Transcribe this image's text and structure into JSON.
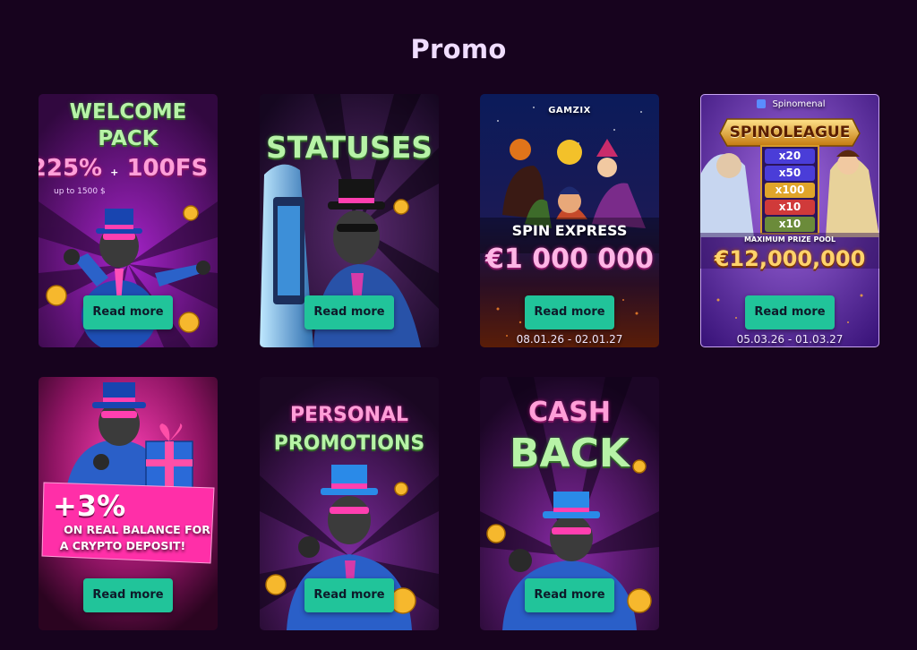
{
  "page": {
    "title": "Promo"
  },
  "promos": [
    {
      "name": "welcome-pack",
      "line1": "WELCOME",
      "line2": "PACK",
      "percent": "225%",
      "plus": "+",
      "freespins": "100FS",
      "note": "up to 1500 $",
      "button": "Read more"
    },
    {
      "name": "statuses",
      "line1": "STATUSES",
      "button": "Read more"
    },
    {
      "name": "spin-express",
      "brand": "GAMZIX",
      "line1": "SPIN EXPRESS",
      "prize": "€1 000 000",
      "dates": "08.01.26 - 02.01.27",
      "button": "Read more"
    },
    {
      "name": "spinoleague",
      "brand": "Spinomenal",
      "line1": "SPINOLEAGUE",
      "multipliers": [
        "x20",
        "x50",
        "x100",
        "x10",
        "x10"
      ],
      "pool_label": "MAXIMUM PRIZE POOL",
      "prize": "€12,000,000",
      "dates": "05.03.26 - 01.03.27",
      "button": "Read more"
    },
    {
      "name": "crypto-deposit",
      "percent": "+3%",
      "line1": "ON REAL BALANCE FOR",
      "line2": "A CRYPTO DEPOSIT!",
      "button": "Read more"
    },
    {
      "name": "personal-promotions",
      "line1": "PERSONAL",
      "line2": "PROMOTIONS",
      "button": "Read more"
    },
    {
      "name": "cash-back",
      "line1": "CASH",
      "line2": "BACK",
      "button": "Read more"
    }
  ],
  "colors": {
    "background": "#17031e",
    "button": "#21c49a",
    "title": "#f0ddff"
  },
  "icons": [
    "gorilla-mascot-icon",
    "coin-icon",
    "top-hat-icon",
    "slot-machine-icon",
    "gift-box-icon",
    "spinomenal-logo-icon"
  ]
}
